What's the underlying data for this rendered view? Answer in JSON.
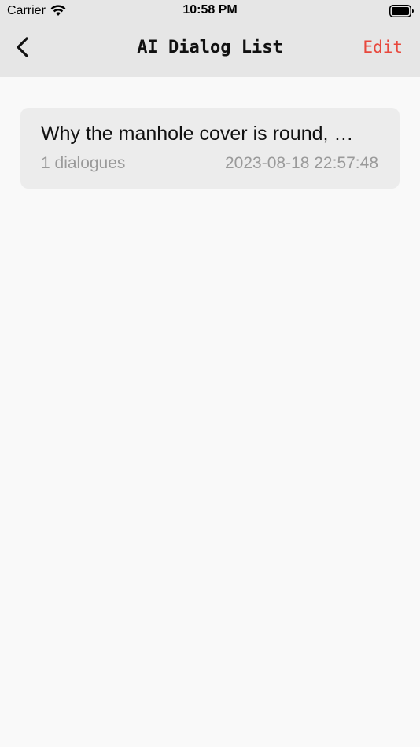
{
  "status_bar": {
    "carrier": "Carrier",
    "time": "10:58 PM"
  },
  "nav": {
    "title": "AI Dialog List",
    "edit_label": "Edit",
    "back_icon": "chevron-left-icon",
    "accent_color": "#e8483d"
  },
  "dialogs": [
    {
      "title": "Why the manhole cover is round, …",
      "count": "1 dialogues",
      "timestamp": "2023-08-18 22:57:48"
    }
  ]
}
